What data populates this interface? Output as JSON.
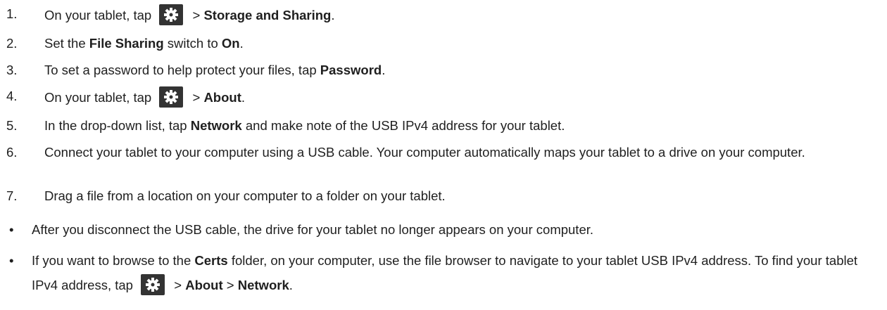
{
  "steps": [
    {
      "number": "1.",
      "parts": [
        "On your tablet, tap ",
        "{gear}",
        " > ",
        "**Storage and Sharing**",
        "."
      ]
    },
    {
      "number": "2.",
      "parts": [
        "Set the ",
        "**File Sharing**",
        " switch to ",
        "**On**",
        "."
      ]
    },
    {
      "number": "3.",
      "parts": [
        "To set a password to help protect your files, tap ",
        "**Password**",
        "."
      ]
    },
    {
      "number": "4.",
      "parts": [
        "On your tablet, tap ",
        "{gear}",
        " > ",
        "**About**",
        "."
      ]
    },
    {
      "number": "5.",
      "parts": [
        "In the drop-down list, tap ",
        "**Network**",
        " and make note of the USB IPv4 address for your tablet."
      ]
    },
    {
      "number": "6.",
      "parts": [
        "Connect your tablet to your computer using a USB cable. Your computer automatically maps your tablet to a drive on your computer."
      ]
    },
    {
      "number": "7.",
      "parts": [
        "Drag a file from a location on your computer to a folder on your tablet."
      ]
    }
  ],
  "notes": [
    {
      "bullet": "•",
      "parts": [
        "After you disconnect the USB cable, the drive for your tablet no longer appears on your computer."
      ]
    },
    {
      "bullet": "•",
      "parts": [
        "If you want to browse to the ",
        "**Certs**",
        " folder, on your computer, use the file browser to navigate to your tablet USB IPv4 address. To find your tablet IPv4 address, tap ",
        "{gear}",
        " > ",
        "**About**",
        " > ",
        "**Network**",
        "."
      ]
    }
  ],
  "icons": {
    "settings": "gear-icon"
  },
  "colors": {
    "text": "#1f1f1f",
    "icon_bg": "#333333",
    "icon_fg": "#ffffff"
  }
}
